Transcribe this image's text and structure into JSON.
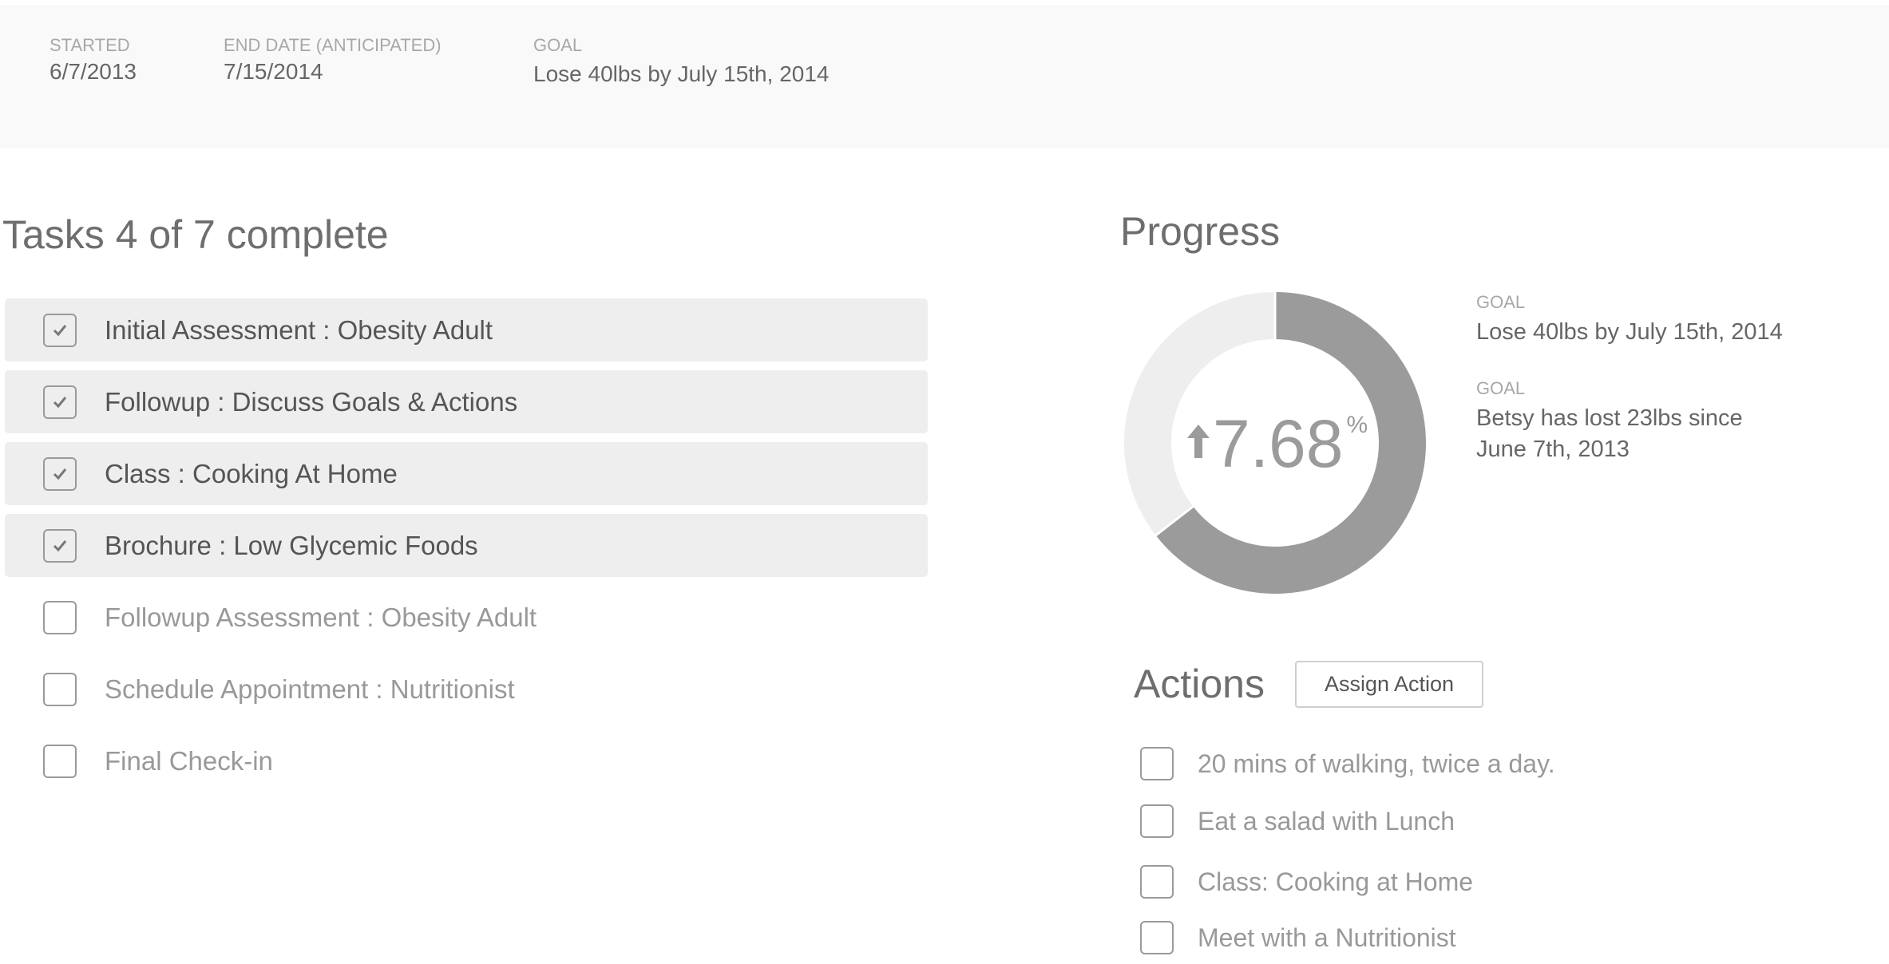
{
  "header": {
    "started_label": "STARTED",
    "started_value": "6/7/2013",
    "end_label": "END DATE (ANTICIPATED)",
    "end_value": "7/15/2014",
    "goal_label": "GOAL",
    "goal_value": "Lose 40lbs by July 15th, 2014"
  },
  "tasks": {
    "title": "Tasks 4 of 7 complete",
    "items": [
      {
        "label": "Initial Assessment :  Obesity Adult",
        "checked": true
      },
      {
        "label": "Followup : Discuss Goals & Actions",
        "checked": true
      },
      {
        "label": "Class : Cooking At Home",
        "checked": true
      },
      {
        "label": "Brochure : Low Glycemic Foods",
        "checked": true
      },
      {
        "label": "Followup Assessment : Obesity Adult",
        "checked": false
      },
      {
        "label": "Schedule Appointment : Nutritionist",
        "checked": false
      },
      {
        "label": "Final Check-in",
        "checked": false
      }
    ]
  },
  "progress": {
    "title": "Progress",
    "value": "7.68",
    "unit": "%",
    "trend_icon": "arrow-up-icon",
    "filled_fraction": 0.645,
    "colors": {
      "filled": "#9b9b9b",
      "remaining": "#eeeeee"
    },
    "goal1_label": "GOAL",
    "goal1_value": "Lose 40lbs by July 15th, 2014",
    "goal2_label": "GOAL",
    "goal2_line1": "Betsy has lost 23lbs since",
    "goal2_line2": "June 7th, 2013"
  },
  "actions": {
    "title": "Actions",
    "assign_button": "Assign Action",
    "items": [
      {
        "label": "20 mins of walking, twice a day.",
        "checked": false
      },
      {
        "label": "Eat a salad with Lunch",
        "checked": false
      },
      {
        "label": "Class: Cooking at Home",
        "checked": false
      },
      {
        "label": "Meet with a Nutritionist",
        "checked": false
      }
    ]
  }
}
